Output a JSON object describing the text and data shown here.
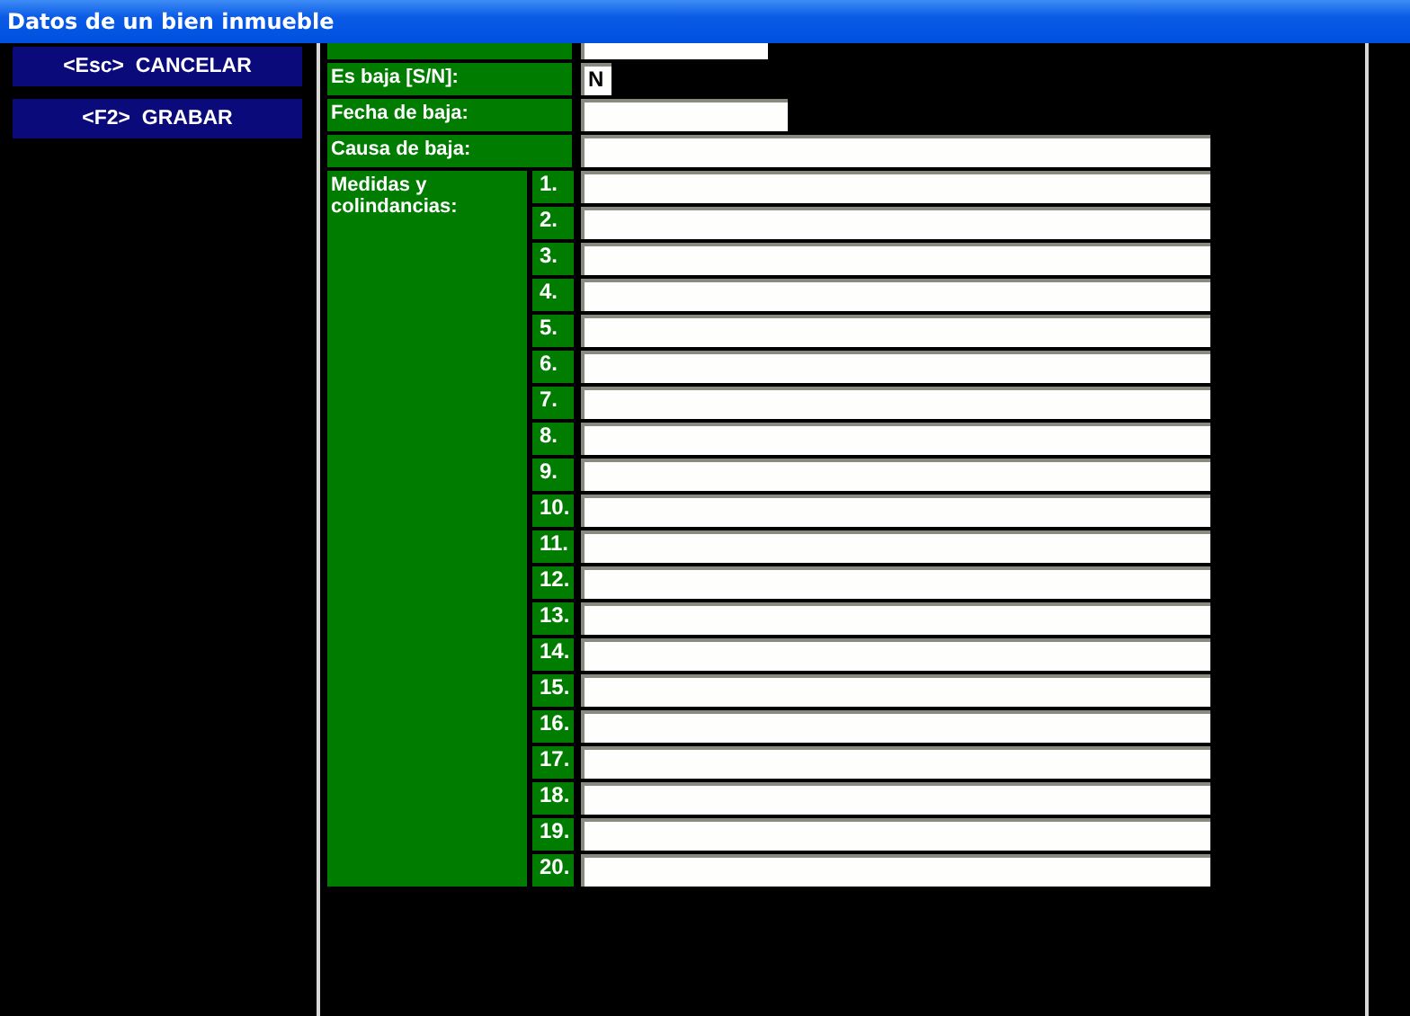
{
  "window": {
    "title": "Datos de un bien inmueble"
  },
  "buttons": [
    {
      "label": "<Esc>  CANCELAR"
    },
    {
      "label": "<F2>  GRABAR"
    }
  ],
  "fields": [
    {
      "label": "Es baja [S/N]:",
      "kind": "flag",
      "value": "N"
    },
    {
      "label": "Fecha de baja:",
      "kind": "date"
    },
    {
      "label": "Causa de baja:",
      "kind": "long"
    }
  ],
  "medidas": {
    "label": "Medidas y colindancias:",
    "lines": [
      "1.",
      "2.",
      "3.",
      "4.",
      "5.",
      "6.",
      "7.",
      "8.",
      "9.",
      "10.",
      "11.",
      "12.",
      "13.",
      "14.",
      "15.",
      "16.",
      "17.",
      "18.",
      "19.",
      "20."
    ]
  }
}
